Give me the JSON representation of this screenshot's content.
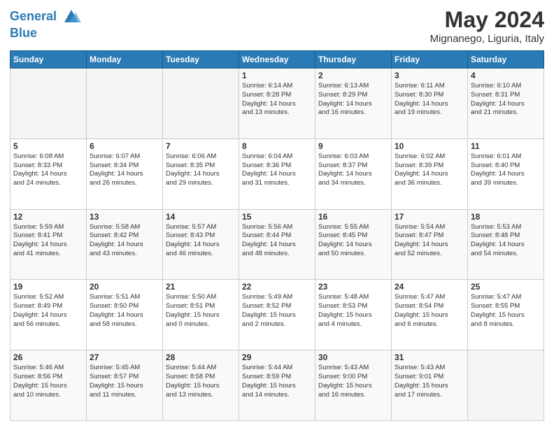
{
  "header": {
    "logo_line1": "General",
    "logo_line2": "Blue",
    "month_title": "May 2024",
    "location": "Mignanego, Liguria, Italy"
  },
  "weekdays": [
    "Sunday",
    "Monday",
    "Tuesday",
    "Wednesday",
    "Thursday",
    "Friday",
    "Saturday"
  ],
  "weeks": [
    [
      {
        "day": "",
        "info": ""
      },
      {
        "day": "",
        "info": ""
      },
      {
        "day": "",
        "info": ""
      },
      {
        "day": "1",
        "info": "Sunrise: 6:14 AM\nSunset: 8:28 PM\nDaylight: 14 hours\nand 13 minutes."
      },
      {
        "day": "2",
        "info": "Sunrise: 6:13 AM\nSunset: 8:29 PM\nDaylight: 14 hours\nand 16 minutes."
      },
      {
        "day": "3",
        "info": "Sunrise: 6:11 AM\nSunset: 8:30 PM\nDaylight: 14 hours\nand 19 minutes."
      },
      {
        "day": "4",
        "info": "Sunrise: 6:10 AM\nSunset: 8:31 PM\nDaylight: 14 hours\nand 21 minutes."
      }
    ],
    [
      {
        "day": "5",
        "info": "Sunrise: 6:08 AM\nSunset: 8:33 PM\nDaylight: 14 hours\nand 24 minutes."
      },
      {
        "day": "6",
        "info": "Sunrise: 6:07 AM\nSunset: 8:34 PM\nDaylight: 14 hours\nand 26 minutes."
      },
      {
        "day": "7",
        "info": "Sunrise: 6:06 AM\nSunset: 8:35 PM\nDaylight: 14 hours\nand 29 minutes."
      },
      {
        "day": "8",
        "info": "Sunrise: 6:04 AM\nSunset: 8:36 PM\nDaylight: 14 hours\nand 31 minutes."
      },
      {
        "day": "9",
        "info": "Sunrise: 6:03 AM\nSunset: 8:37 PM\nDaylight: 14 hours\nand 34 minutes."
      },
      {
        "day": "10",
        "info": "Sunrise: 6:02 AM\nSunset: 8:39 PM\nDaylight: 14 hours\nand 36 minutes."
      },
      {
        "day": "11",
        "info": "Sunrise: 6:01 AM\nSunset: 8:40 PM\nDaylight: 14 hours\nand 39 minutes."
      }
    ],
    [
      {
        "day": "12",
        "info": "Sunrise: 5:59 AM\nSunset: 8:41 PM\nDaylight: 14 hours\nand 41 minutes."
      },
      {
        "day": "13",
        "info": "Sunrise: 5:58 AM\nSunset: 8:42 PM\nDaylight: 14 hours\nand 43 minutes."
      },
      {
        "day": "14",
        "info": "Sunrise: 5:57 AM\nSunset: 8:43 PM\nDaylight: 14 hours\nand 46 minutes."
      },
      {
        "day": "15",
        "info": "Sunrise: 5:56 AM\nSunset: 8:44 PM\nDaylight: 14 hours\nand 48 minutes."
      },
      {
        "day": "16",
        "info": "Sunrise: 5:55 AM\nSunset: 8:45 PM\nDaylight: 14 hours\nand 50 minutes."
      },
      {
        "day": "17",
        "info": "Sunrise: 5:54 AM\nSunset: 8:47 PM\nDaylight: 14 hours\nand 52 minutes."
      },
      {
        "day": "18",
        "info": "Sunrise: 5:53 AM\nSunset: 8:48 PM\nDaylight: 14 hours\nand 54 minutes."
      }
    ],
    [
      {
        "day": "19",
        "info": "Sunrise: 5:52 AM\nSunset: 8:49 PM\nDaylight: 14 hours\nand 56 minutes."
      },
      {
        "day": "20",
        "info": "Sunrise: 5:51 AM\nSunset: 8:50 PM\nDaylight: 14 hours\nand 58 minutes."
      },
      {
        "day": "21",
        "info": "Sunrise: 5:50 AM\nSunset: 8:51 PM\nDaylight: 15 hours\nand 0 minutes."
      },
      {
        "day": "22",
        "info": "Sunrise: 5:49 AM\nSunset: 8:52 PM\nDaylight: 15 hours\nand 2 minutes."
      },
      {
        "day": "23",
        "info": "Sunrise: 5:48 AM\nSunset: 8:53 PM\nDaylight: 15 hours\nand 4 minutes."
      },
      {
        "day": "24",
        "info": "Sunrise: 5:47 AM\nSunset: 8:54 PM\nDaylight: 15 hours\nand 6 minutes."
      },
      {
        "day": "25",
        "info": "Sunrise: 5:47 AM\nSunset: 8:55 PM\nDaylight: 15 hours\nand 8 minutes."
      }
    ],
    [
      {
        "day": "26",
        "info": "Sunrise: 5:46 AM\nSunset: 8:56 PM\nDaylight: 15 hours\nand 10 minutes."
      },
      {
        "day": "27",
        "info": "Sunrise: 5:45 AM\nSunset: 8:57 PM\nDaylight: 15 hours\nand 11 minutes."
      },
      {
        "day": "28",
        "info": "Sunrise: 5:44 AM\nSunset: 8:58 PM\nDaylight: 15 hours\nand 13 minutes."
      },
      {
        "day": "29",
        "info": "Sunrise: 5:44 AM\nSunset: 8:59 PM\nDaylight: 15 hours\nand 14 minutes."
      },
      {
        "day": "30",
        "info": "Sunrise: 5:43 AM\nSunset: 9:00 PM\nDaylight: 15 hours\nand 16 minutes."
      },
      {
        "day": "31",
        "info": "Sunrise: 5:43 AM\nSunset: 9:01 PM\nDaylight: 15 hours\nand 17 minutes."
      },
      {
        "day": "",
        "info": ""
      }
    ]
  ]
}
